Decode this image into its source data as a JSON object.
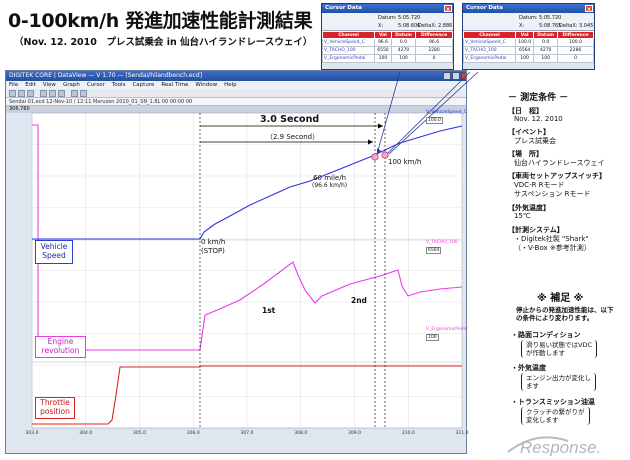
{
  "page": {
    "title": "0-100km/h 発進加速性能計測結果",
    "subtitle": "（Nov. 12. 2010　プレス試乗会 in 仙台ハイランドレースウェイ）"
  },
  "app": {
    "window_title": "DIGITEK CORE  |  DataView  —  V 1.70  —  [Sendai/hilandbench.ecd]",
    "menu": [
      "File",
      "Edit",
      "View",
      "Graph",
      "Cursor",
      "Tools",
      "Capture",
      "Real Time",
      "Window",
      "Help"
    ],
    "status_strip": "Sendai 01.ecd   12-Nov-10 / 12:11   Maruzen   2010_01_SN_1.8L 00 00:00 00",
    "ruler_left": "306.760"
  },
  "cursor_dialogs": [
    {
      "title": "Cursor Data",
      "datum_label": "Datum:",
      "datum_value": "5:05.720",
      "x_label": "X:",
      "x_value": "5:08.606",
      "delta_label": "DeltaX:",
      "delta_value": "2.886",
      "headers": [
        "Channel",
        "Val",
        "Datum",
        "Difference"
      ],
      "rows": [
        [
          "V_VehicleSpeed_C",
          "96.6",
          "0.0",
          "96.6"
        ],
        [
          "V_TACHO_100",
          "6550",
          "4270",
          "2280"
        ],
        [
          "V_ErgonomicPedal",
          "100",
          "100",
          "0"
        ]
      ],
      "close_label": "×"
    },
    {
      "title": "Cursor Data",
      "datum_label": "Datum:",
      "datum_value": "5:05.720",
      "x_label": "X:",
      "x_value": "5:08.765",
      "delta_label": "DeltaX:",
      "delta_value": "3.045",
      "headers": [
        "Channel",
        "Val",
        "Datum",
        "Difference"
      ],
      "rows": [
        [
          "V_VehicleSpeed_C",
          "100.0",
          "0.0",
          "100.0"
        ],
        [
          "V_TACHO_100",
          "6564",
          "4270",
          "2286"
        ],
        [
          "V_ErgonomicPedal",
          "100",
          "100",
          "0"
        ]
      ],
      "close_label": "×"
    }
  ],
  "plot": {
    "channel_labels": {
      "vehicle_speed": "Vehicle\nSpeed",
      "engine_revolution": "Engine\nrevolution",
      "throttle_position": "Throttle\nposition"
    },
    "side_labels": [
      {
        "name": "V_VehicleSpeed_C",
        "value": "100.0"
      },
      {
        "name": "V_TACHO_100",
        "value": "6564"
      },
      {
        "name": "V_ErgonomicPedal",
        "value": "100"
      }
    ],
    "annotations": {
      "time_3": "3.0 Second",
      "time_29": "（2.9 Second）",
      "mph_60": "60 mile/h",
      "kmh_96": "(96.6 km/h)",
      "kmh_100": "100 km/h",
      "kmh_0": "0 km/h",
      "stop": "(STOP)",
      "gear_1": "1st",
      "gear_2": "2nd"
    },
    "x_ticks": [
      "303.0",
      "304.0",
      "305.0",
      "306.0",
      "307.0",
      "308.0",
      "309.0",
      "310.0",
      "311.0"
    ],
    "colors": {
      "speed": "#2b35e0",
      "rpm": "#ee3be8",
      "throttle": "#e4201c",
      "grid": "#d8dbe2",
      "arrow": "#2a3a9a"
    }
  },
  "conditions": {
    "heading": "－ 測定条件 －",
    "items": [
      {
        "label": "【日　程】",
        "value": "Nov. 12. 2010"
      },
      {
        "label": "【イベント】",
        "value": "プレス試乗会"
      },
      {
        "label": "【場　所】",
        "value": "仙台ハイランドレースウェイ"
      },
      {
        "label": "【車両セットアップスイッチ】",
        "value": "VDC-R Rモード",
        "value2": "サスペンション Rモード"
      },
      {
        "label": "【外気温度】",
        "value": "15℃"
      },
      {
        "label": "【計測システム】",
        "value": "・Digitek社製 \"Shark\"",
        "value2": "（・V-Box ※参考計測）"
      }
    ]
  },
  "notes": {
    "heading": "※ 補足 ※",
    "intro": "停止からの発進加速性能は、以下の条件により変わります。",
    "items": [
      {
        "title": "・路面コンディション",
        "body1": "滑り易い状態ではVDC",
        "body2": "が作動します"
      },
      {
        "title": "・外気温度",
        "body1": "エンジン出力が変化し",
        "body2": "ます"
      },
      {
        "title": "・トランスミッション油温",
        "body1": "クラッチの繋がりが",
        "body2": "変化します"
      }
    ]
  },
  "watermark": {
    "text": "Response."
  }
}
